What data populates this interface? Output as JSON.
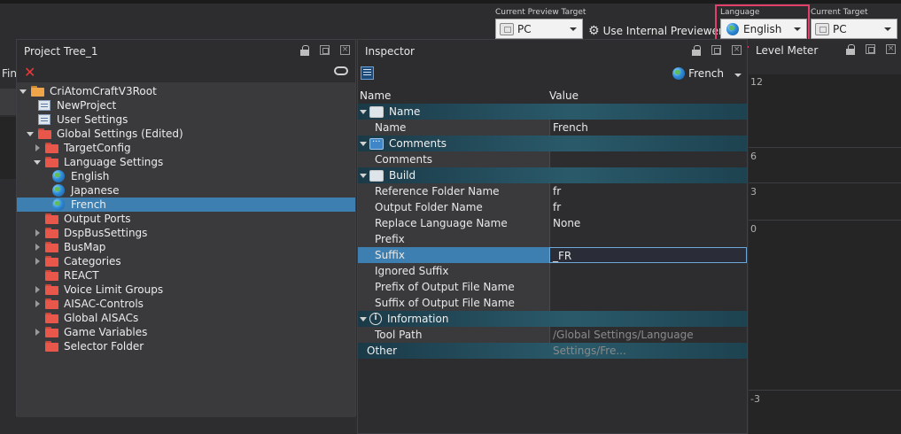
{
  "toolbar": {
    "preview_target_label": "Current Preview Target",
    "preview_target_value": "PC",
    "use_internal_previewer": "Use Internal Previewer",
    "language_label": "Language",
    "language_value": "English",
    "current_target_label": "Current Target",
    "current_target_value": "PC"
  },
  "left_stub": {
    "label": "Fin"
  },
  "project_tree": {
    "title": "Project Tree_1",
    "items": [
      {
        "label": "CriAtomCraftV3Root",
        "icon": "folder-icon",
        "depth": 0,
        "expander": "down"
      },
      {
        "label": "NewProject",
        "icon": "project-icon",
        "depth": 1,
        "expander": "none"
      },
      {
        "label": "User Settings",
        "icon": "user-settings-icon",
        "depth": 1,
        "expander": "none"
      },
      {
        "label": "Global Settings (Edited)",
        "icon": "folder-icon",
        "depth": 1,
        "expander": "down"
      },
      {
        "label": "TargetConfig",
        "icon": "folder-icon",
        "depth": 2,
        "expander": "right"
      },
      {
        "label": "Language Settings",
        "icon": "folder-icon",
        "depth": 2,
        "expander": "down"
      },
      {
        "label": "English",
        "icon": "globe-icon",
        "depth": 3,
        "expander": "none"
      },
      {
        "label": "Japanese",
        "icon": "globe-icon",
        "depth": 3,
        "expander": "none"
      },
      {
        "label": "French",
        "icon": "globe-icon",
        "depth": 3,
        "expander": "none",
        "selected": true
      },
      {
        "label": "Output Ports",
        "icon": "folder-icon",
        "depth": 2,
        "expander": "none"
      },
      {
        "label": "DspBusSettings",
        "icon": "folder-icon",
        "depth": 2,
        "expander": "right"
      },
      {
        "label": "BusMap",
        "icon": "folder-icon",
        "depth": 2,
        "expander": "right"
      },
      {
        "label": "Categories",
        "icon": "folder-icon",
        "depth": 2,
        "expander": "right"
      },
      {
        "label": "REACT",
        "icon": "folder-icon",
        "depth": 2,
        "expander": "none"
      },
      {
        "label": "Voice Limit Groups",
        "icon": "folder-icon",
        "depth": 2,
        "expander": "right"
      },
      {
        "label": "AISAC-Controls",
        "icon": "folder-icon",
        "depth": 2,
        "expander": "right"
      },
      {
        "label": "Global AISACs",
        "icon": "folder-icon",
        "depth": 2,
        "expander": "none"
      },
      {
        "label": "Game Variables",
        "icon": "folder-icon",
        "depth": 2,
        "expander": "right"
      },
      {
        "label": "Selector Folder",
        "icon": "folder-icon",
        "depth": 2,
        "expander": "none"
      }
    ]
  },
  "inspector": {
    "title": "Inspector",
    "language": "French",
    "col_name": "Name",
    "col_value": "Value",
    "sections": [
      {
        "title": "Name",
        "icon": "name-section-icon",
        "rows": [
          {
            "key": "Name",
            "value": "French"
          }
        ]
      },
      {
        "title": "Comments",
        "icon": "comments-section-icon",
        "rows": [
          {
            "key": "Comments",
            "value": ""
          }
        ]
      },
      {
        "title": "Build",
        "icon": "build-section-icon",
        "rows": [
          {
            "key": "Reference Folder Name",
            "value": "fr"
          },
          {
            "key": "Output Folder Name",
            "value": "fr"
          },
          {
            "key": "Replace Language Name",
            "value": "None"
          },
          {
            "key": "Prefix",
            "value": ""
          },
          {
            "key": "Suffix",
            "value": "_FR",
            "selected": true
          },
          {
            "key": "Ignored Suffix",
            "value": ""
          },
          {
            "key": "Prefix of Output File Name",
            "value": ""
          },
          {
            "key": "Suffix of Output File Name",
            "value": ""
          }
        ]
      },
      {
        "title": "Information",
        "icon": "info-section-icon",
        "rows": [
          {
            "key": "Tool Path",
            "value": "/Global Settings/Language Settings/Fre...",
            "dim": true
          }
        ]
      }
    ],
    "other_label": "Other"
  },
  "level_meter": {
    "title": "Level Meter",
    "ticks": [
      "12",
      "6",
      "3",
      "0",
      "-3"
    ]
  }
}
